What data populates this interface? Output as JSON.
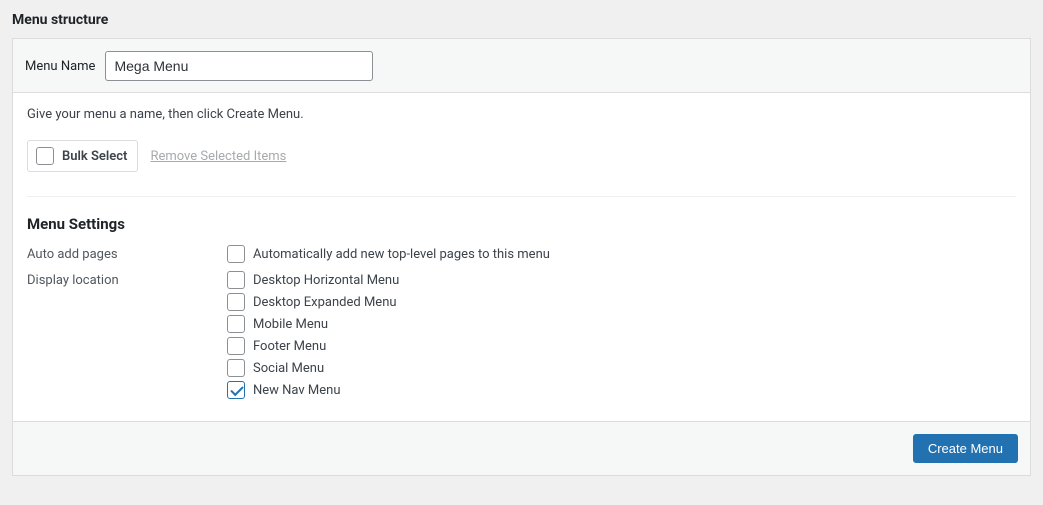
{
  "title": "Menu structure",
  "menuNameLabel": "Menu Name",
  "menuNameValue": "Mega Menu",
  "instruction": "Give your menu a name, then click Create Menu.",
  "bulkSelectLabel": "Bulk Select",
  "removeSelectedLabel": "Remove Selected Items",
  "settingsTitle": "Menu Settings",
  "autoAddLabel": "Auto add pages",
  "autoAddOption": "Automatically add new top-level pages to this menu",
  "displayLocationLabel": "Display location",
  "locations": [
    {
      "label": "Desktop Horizontal Menu",
      "checked": false
    },
    {
      "label": "Desktop Expanded Menu",
      "checked": false
    },
    {
      "label": "Mobile Menu",
      "checked": false
    },
    {
      "label": "Footer Menu",
      "checked": false
    },
    {
      "label": "Social Menu",
      "checked": false
    },
    {
      "label": "New Nav Menu",
      "checked": true
    }
  ],
  "createButton": "Create Menu"
}
